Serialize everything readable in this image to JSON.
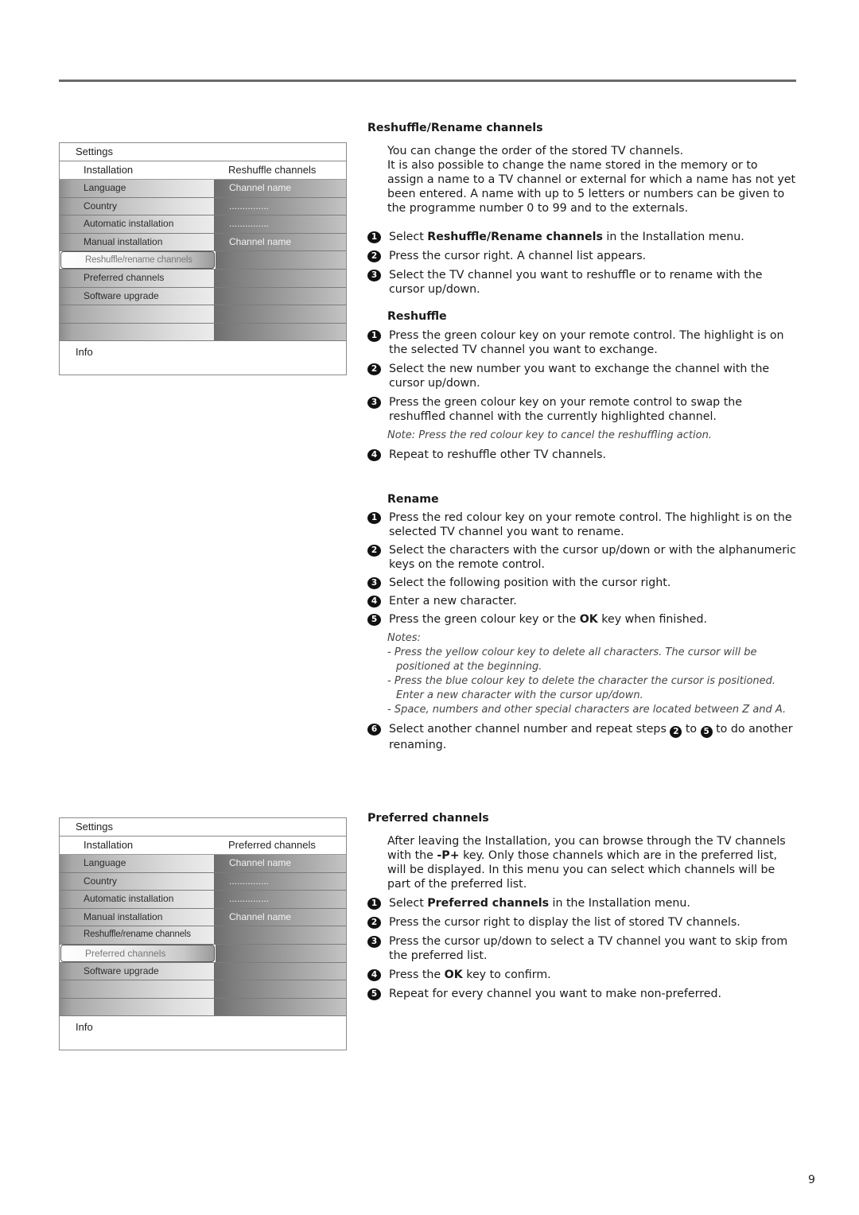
{
  "page_number": "9",
  "menu1": {
    "header": "Settings",
    "sub_left": "Installation",
    "sub_right": "Reshuffle channels",
    "rows": [
      {
        "left": "Language",
        "right": "Channel name"
      },
      {
        "left": "Country",
        "right": "..............."
      },
      {
        "left": "Automatic installation",
        "right": "..............."
      },
      {
        "left": "Manual installation",
        "right": "Channel name"
      },
      {
        "left": "Reshuffle/rename channels",
        "right": "",
        "selected": true
      },
      {
        "left": "Preferred channels",
        "right": ""
      },
      {
        "left": "Software upgrade",
        "right": ""
      },
      {
        "left": "",
        "right": ""
      },
      {
        "left": "",
        "right": ""
      }
    ],
    "info": "Info"
  },
  "menu2": {
    "header": "Settings",
    "sub_left": "Installation",
    "sub_right": "Preferred channels",
    "rows": [
      {
        "left": "Language",
        "right": "Channel name"
      },
      {
        "left": "Country",
        "right": "..............."
      },
      {
        "left": "Automatic installation",
        "right": "..............."
      },
      {
        "left": "Manual installation",
        "right": "Channel name"
      },
      {
        "left": "Reshuffle/rename channels",
        "right": ""
      },
      {
        "left": "Preferred channels",
        "right": "",
        "selected": true
      },
      {
        "left": "Software upgrade",
        "right": ""
      },
      {
        "left": "",
        "right": ""
      },
      {
        "left": "",
        "right": ""
      }
    ],
    "info": "Info"
  },
  "reshuffle_rename": {
    "title": "Reshuffle/Rename channels",
    "intro1": "You can change the order of the stored TV channels.",
    "intro2": "It is also possible to change the name stored in the memory or to assign a name to a TV channel or external for which a name has not yet been entered. A name with up to 5 letters or numbers can be given to the programme number 0 to 99 and to the externals.",
    "steps": [
      {
        "n": "1",
        "pre": "Select ",
        "bold": "Reshuffle/Rename channels",
        "post": " in the Installation menu."
      },
      {
        "n": "2",
        "text": "Press the cursor right. A channel list appears."
      },
      {
        "n": "3",
        "text": "Select the TV channel you want to reshuffle or to rename with the cursor up/down."
      }
    ],
    "reshuffle": {
      "title": "Reshuffle",
      "steps": [
        {
          "n": "1",
          "text": "Press the green colour key on your remote control. The highlight is on the selected TV channel you want to exchange."
        },
        {
          "n": "2",
          "text": "Select the new number you want to exchange the channel with the cursor up/down."
        },
        {
          "n": "3",
          "text": "Press the green colour key on your remote control to swap the reshuffled channel with the currently highlighted channel."
        }
      ],
      "note": "Note: Press the red colour key to cancel the reshuffling action.",
      "step4": {
        "n": "4",
        "text": "Repeat to reshuffle other TV channels."
      }
    },
    "rename": {
      "title": "Rename",
      "steps": [
        {
          "n": "1",
          "text": "Press the red colour key on your remote control. The highlight is on the selected TV channel you want to rename."
        },
        {
          "n": "2",
          "text": "Select the characters with the cursor up/down or with the alphanumeric keys on the remote control."
        },
        {
          "n": "3",
          "text": "Select the following position with the cursor right."
        },
        {
          "n": "4",
          "text": "Enter a new character."
        },
        {
          "n": "5",
          "pre": "Press the green colour key or the ",
          "bold": "OK",
          "post": " key when finished."
        }
      ],
      "notes_title": "Notes:",
      "notes": [
        "- Press the yellow colour key to delete all characters. The cursor will be positioned at the beginning.",
        "- Press the blue colour key to delete the character the cursor is positioned. Enter a new character with the cursor up/down.",
        "- Space, numbers and other special characters are located between Z and A."
      ],
      "step6": {
        "n": "6",
        "pre": "Select another channel number and repeat steps ",
        "ref1": "2",
        "mid": " to ",
        "ref2": "5",
        "post": " to do another renaming."
      }
    }
  },
  "preferred": {
    "title": "Preferred channels",
    "intro_pre": "After leaving the Installation, you can browse through the TV channels with the ",
    "intro_bold": "-P+",
    "intro_post": " key. Only those channels which are in the preferred list, will be displayed. In this menu you can select which channels will be part of the preferred list.",
    "steps": [
      {
        "n": "1",
        "pre": "Select ",
        "bold": "Preferred channels",
        "post": " in the Installation menu."
      },
      {
        "n": "2",
        "text": "Press the cursor right to display the list of stored TV channels."
      },
      {
        "n": "3",
        "text": "Press the cursor up/down to select a TV channel you want to skip from the preferred list."
      },
      {
        "n": "4",
        "pre": "Press the ",
        "bold": "OK",
        "post": " key to confirm."
      },
      {
        "n": "5",
        "text": "Repeat for every channel you want to make non-preferred."
      }
    ]
  }
}
